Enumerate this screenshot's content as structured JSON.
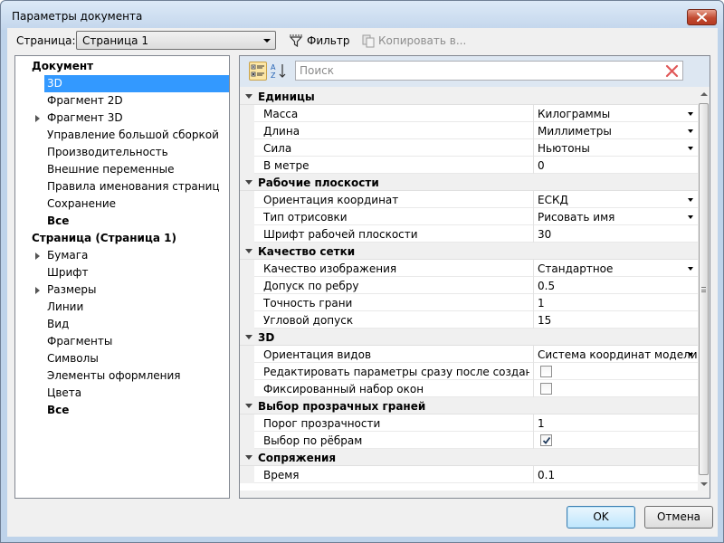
{
  "window": {
    "title": "Параметры документа"
  },
  "toolbar": {
    "page_label": "Страница:",
    "page_value": "Страница 1",
    "filter_label": "Фильтр",
    "copy_label": "Копировать в..."
  },
  "tree": [
    {
      "label": "Документ",
      "level": 0,
      "bold": true,
      "expander": false,
      "selected": false
    },
    {
      "label": "3D",
      "level": 1,
      "bold": false,
      "expander": true,
      "selected": true
    },
    {
      "label": "Фрагмент 2D",
      "level": 1,
      "bold": false,
      "expander": false,
      "selected": false
    },
    {
      "label": "Фрагмент 3D",
      "level": 1,
      "bold": false,
      "expander": true,
      "selected": false
    },
    {
      "label": "Управление большой сборкой",
      "level": 1,
      "bold": false,
      "expander": false,
      "selected": false
    },
    {
      "label": "Производительность",
      "level": 1,
      "bold": false,
      "expander": false,
      "selected": false
    },
    {
      "label": "Внешние переменные",
      "level": 1,
      "bold": false,
      "expander": false,
      "selected": false
    },
    {
      "label": "Правила именования страниц",
      "level": 1,
      "bold": false,
      "expander": false,
      "selected": false
    },
    {
      "label": "Сохранение",
      "level": 1,
      "bold": false,
      "expander": false,
      "selected": false
    },
    {
      "label": "Все",
      "level": 1,
      "bold": true,
      "expander": false,
      "selected": false
    },
    {
      "label": "Страница (Страница 1)",
      "level": 0,
      "bold": true,
      "expander": false,
      "selected": false
    },
    {
      "label": "Бумага",
      "level": 1,
      "bold": false,
      "expander": true,
      "selected": false
    },
    {
      "label": "Шрифт",
      "level": 1,
      "bold": false,
      "expander": false,
      "selected": false
    },
    {
      "label": "Размеры",
      "level": 1,
      "bold": false,
      "expander": true,
      "selected": false
    },
    {
      "label": "Линии",
      "level": 1,
      "bold": false,
      "expander": false,
      "selected": false
    },
    {
      "label": "Вид",
      "level": 1,
      "bold": false,
      "expander": false,
      "selected": false
    },
    {
      "label": "Фрагменты",
      "level": 1,
      "bold": false,
      "expander": false,
      "selected": false
    },
    {
      "label": "Символы",
      "level": 1,
      "bold": false,
      "expander": false,
      "selected": false
    },
    {
      "label": "Элементы оформления",
      "level": 1,
      "bold": false,
      "expander": false,
      "selected": false
    },
    {
      "label": "Цвета",
      "level": 1,
      "bold": false,
      "expander": false,
      "selected": false
    },
    {
      "label": "Все",
      "level": 1,
      "bold": true,
      "expander": false,
      "selected": false
    }
  ],
  "search": {
    "placeholder": "Поиск",
    "value": ""
  },
  "properties": [
    {
      "category": "Единицы",
      "rows": [
        {
          "name": "Масса",
          "value": "Килограммы",
          "type": "dropdown"
        },
        {
          "name": "Длина",
          "value": "Миллиметры",
          "type": "dropdown"
        },
        {
          "name": "Сила",
          "value": "Ньютоны",
          "type": "dropdown"
        },
        {
          "name": "В метре",
          "value": "0",
          "type": "text"
        }
      ]
    },
    {
      "category": "Рабочие плоскости",
      "rows": [
        {
          "name": "Ориентация координат",
          "value": "ЕСКД",
          "type": "dropdown"
        },
        {
          "name": "Тип отрисовки",
          "value": "Рисовать имя",
          "type": "dropdown"
        },
        {
          "name": "Шрифт рабочей плоскости",
          "value": "30",
          "type": "text"
        }
      ]
    },
    {
      "category": "Качество сетки",
      "rows": [
        {
          "name": "Качество изображения",
          "value": "Стандартное",
          "type": "dropdown"
        },
        {
          "name": "Допуск по ребру",
          "value": "0.5",
          "type": "text"
        },
        {
          "name": "Точность грани",
          "value": "1",
          "type": "text"
        },
        {
          "name": "Угловой допуск",
          "value": "15",
          "type": "text"
        }
      ]
    },
    {
      "category": "3D",
      "rows": [
        {
          "name": "Ориентация видов",
          "value": "Система координат модели",
          "type": "dropdown"
        },
        {
          "name": "Редактировать параметры сразу после создания (т...",
          "value": false,
          "type": "checkbox"
        },
        {
          "name": "Фиксированный набор окон",
          "value": false,
          "type": "checkbox"
        }
      ]
    },
    {
      "category": "Выбор прозрачных граней",
      "rows": [
        {
          "name": "Порог прозрачности",
          "value": "1",
          "type": "text"
        },
        {
          "name": "Выбор по рёбрам",
          "value": true,
          "type": "checkbox"
        }
      ]
    },
    {
      "category": "Сопряжения",
      "rows": [
        {
          "name": "Время",
          "value": "0.1",
          "type": "text"
        }
      ]
    }
  ],
  "buttons": {
    "ok": "OK",
    "cancel": "Отмена"
  },
  "colors": {
    "selection": "#3399ff",
    "title_bar": "#c3d6ec",
    "close_button": "#c24b32",
    "category_row": "#f0f0f0"
  }
}
